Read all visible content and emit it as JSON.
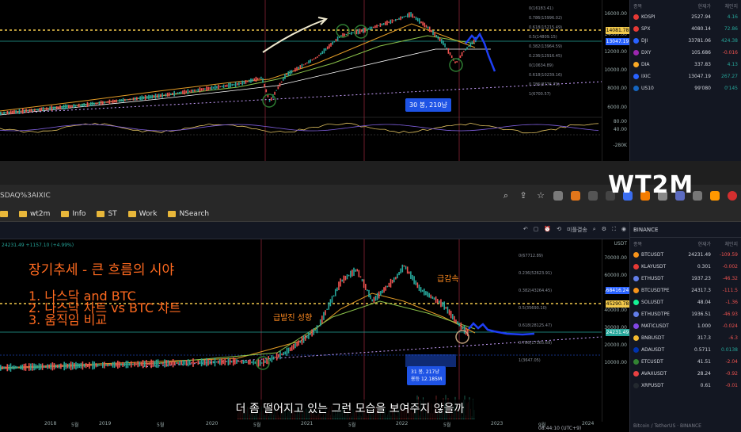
{
  "top_chart": {
    "callout": "30 봉, 210냥",
    "axis_ticks": [
      "16000.00",
      "14000.00",
      "12000.00",
      "10000.00",
      "8000.00",
      "6000.00",
      "80.00",
      "40.00",
      "-280K"
    ],
    "price_tags": [
      {
        "value": "14081.78",
        "color": "#f2c94c"
      },
      {
        "value": "13047.19",
        "color": "#2962ff"
      }
    ],
    "fib_labels": [
      "0(16183.41)",
      "0.786(15996.02)",
      "0.618(15215.49)",
      "0.5(14809.15)",
      "0.382(13964.59)",
      "0.236(12916.45)",
      "0(10634.89)",
      "0.618(10239.16)",
      "0.786(8776.79)",
      "1(6700.57)"
    ]
  },
  "top_watchlist": {
    "headers": [
      "종목",
      "현재가",
      "체인지"
    ],
    "rows": [
      {
        "symbol": "KOSPI",
        "price": "2527.94",
        "change": "4.16",
        "dir": "up",
        "color": "#e53935"
      },
      {
        "symbol": "SPX",
        "price": "4080.14",
        "change": "72.86",
        "dir": "up",
        "color": "#e53935"
      },
      {
        "symbol": "DJI",
        "price": "33781.06",
        "change": "424.38",
        "dir": "up",
        "color": "#2962ff"
      },
      {
        "symbol": "DXY",
        "price": "105.686",
        "change": "-0.016",
        "dir": "down",
        "color": "#9c27b0"
      },
      {
        "symbol": "DIA",
        "price": "337.83",
        "change": "4.13",
        "dir": "up",
        "color": "#f9a825"
      },
      {
        "symbol": "IXIC",
        "price": "13047.19",
        "change": "267.27",
        "dir": "up",
        "color": "#2962ff"
      },
      {
        "symbol": "US10",
        "price": "99'080",
        "change": "0'145",
        "dir": "up",
        "color": "#1565c0"
      }
    ]
  },
  "browser": {
    "url": "SDAQ%3AIXIC",
    "bookmarks": [
      "wt2m",
      "Info",
      "ST",
      "Work",
      "NSearch"
    ]
  },
  "bottom_chart": {
    "ohlc_text": "24231.49 +1157.10 (+4.99%)",
    "title": "장기추세 - 큰 흐름의 시야",
    "list": [
      "1. 나스닥 and BTC",
      "2. 나스닥 차트 vs BTC 차트",
      "3. 움직임 비교"
    ],
    "anno_surge": "급발진 성향",
    "anno_drop": "급감속",
    "callout_line1": "31 봉, 217냥",
    "callout_line2": "용등 12.185M",
    "axis_ticks": [
      "USDT",
      "70000.00",
      "60000.00",
      "50000.00",
      "40000.00",
      "30000.00",
      "20000.00",
      "10000.00"
    ],
    "price_tags": [
      {
        "value": "68416.24",
        "color": "#2962ff"
      },
      {
        "value": "45290.78",
        "color": "#f2c94c"
      },
      {
        "value": "24231.49",
        "color": "#26a69a"
      }
    ],
    "fib_labels": [
      "0(67712.89)",
      "0.236(52623.91)",
      "0.382(43264.45)",
      "0.5(35690.10)",
      "0.618(28125.47)",
      "0.786(17365.69)",
      "1(3647.05)"
    ],
    "xaxis": [
      "2018",
      "5월",
      "2019",
      "5월",
      "2020",
      "5월",
      "2021",
      "5월",
      "2022",
      "5월",
      "2023",
      "9월",
      "2024"
    ],
    "subtitle": "더 좀 떨어지고 있는 그런 모습을 보여주지 않을까",
    "watermark": "WT2M",
    "status_time": "08:44:10 (UTC+9)",
    "toolbar_label": "미플결송"
  },
  "bottom_watchlist": {
    "exchange": "BINANCE",
    "headers": [
      "종목",
      "현재가",
      "체인지"
    ],
    "rows": [
      {
        "symbol": "BTCUSDT",
        "price": "24231.49",
        "change": "-109.59",
        "dir": "down",
        "color": "#f7931a"
      },
      {
        "symbol": "KLAYUSDT",
        "price": "0.301",
        "change": "-0.002",
        "dir": "down",
        "color": "#e53935"
      },
      {
        "symbol": "ETHUSDT",
        "price": "1937.23",
        "change": "-46.32",
        "dir": "down",
        "color": "#627eea"
      },
      {
        "symbol": "BTCUSDTPE",
        "price": "24317.3",
        "change": "-111.5",
        "dir": "down",
        "color": "#f7931a"
      },
      {
        "symbol": "SOLUSDT",
        "price": "48.04",
        "change": "-1.36",
        "dir": "down",
        "color": "#14f195"
      },
      {
        "symbol": "ETHUSDTPE",
        "price": "1936.51",
        "change": "-46.93",
        "dir": "down",
        "color": "#627eea"
      },
      {
        "symbol": "MATICUSDT",
        "price": "1.000",
        "change": "-0.024",
        "dir": "down",
        "color": "#8247e5"
      },
      {
        "symbol": "BNBUSDT",
        "price": "317.3",
        "change": "-6.3",
        "dir": "down",
        "color": "#f3ba2f"
      },
      {
        "symbol": "ADAUSDT",
        "price": "0.5711",
        "change": "0.0138",
        "dir": "up",
        "color": "#0033ad"
      },
      {
        "symbol": "ETCUSDT",
        "price": "41.51",
        "change": "-2.04",
        "dir": "down",
        "color": "#328332"
      },
      {
        "symbol": "AVAXUSDT",
        "price": "28.24",
        "change": "-0.92",
        "dir": "down",
        "color": "#e84142"
      },
      {
        "symbol": "XRPUSDT",
        "price": "0.61",
        "change": "-0.01",
        "dir": "down",
        "color": "#23292f"
      }
    ],
    "footer": "Bitcoin / TetherUS · BINANCE"
  }
}
